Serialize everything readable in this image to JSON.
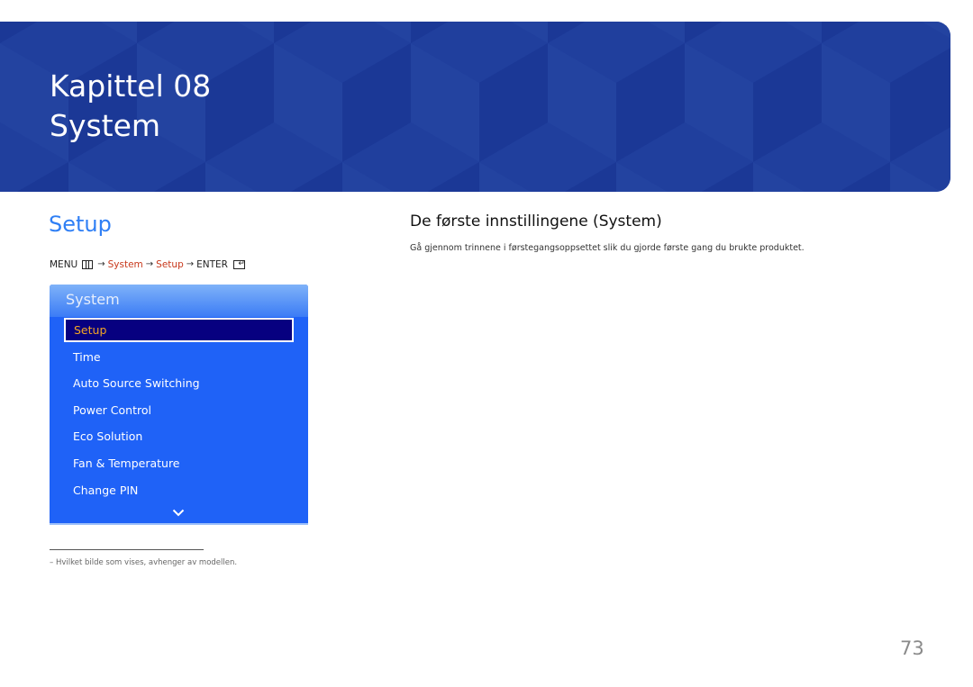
{
  "banner": {
    "chapter_label": "Kapittel 08",
    "chapter_title": "System",
    "background_color": "#1f3d9c"
  },
  "section": {
    "title": "Setup",
    "title_color": "#2f7ff5"
  },
  "breadcrumb": {
    "menu_label": "MENU",
    "menu_icon": "menu-icon",
    "arrow": "→",
    "step1": "System",
    "step2": "Setup",
    "enter_label": "ENTER",
    "enter_icon": "enter-icon",
    "highlight_color": "#c8381b"
  },
  "osd_menu": {
    "title": "System",
    "selected_index": 0,
    "items": [
      {
        "label": "Setup"
      },
      {
        "label": "Time"
      },
      {
        "label": "Auto Source Switching"
      },
      {
        "label": "Power Control"
      },
      {
        "label": "Eco Solution"
      },
      {
        "label": "Fan & Temperature"
      },
      {
        "label": "Change PIN"
      }
    ],
    "more_icon": "chevron-down-icon",
    "panel_color": "#1f62f7",
    "selected_color": "#070080",
    "selected_text_color": "#f5a623"
  },
  "content": {
    "heading": "De første innstillingene (System)",
    "description": "Gå gjennom trinnene i førstegangsoppsettet slik du gjorde første gang du brukte produktet."
  },
  "footnote": {
    "text": "–  Hvilket bilde som vises, avhenger av modellen."
  },
  "page": {
    "number": "73"
  }
}
